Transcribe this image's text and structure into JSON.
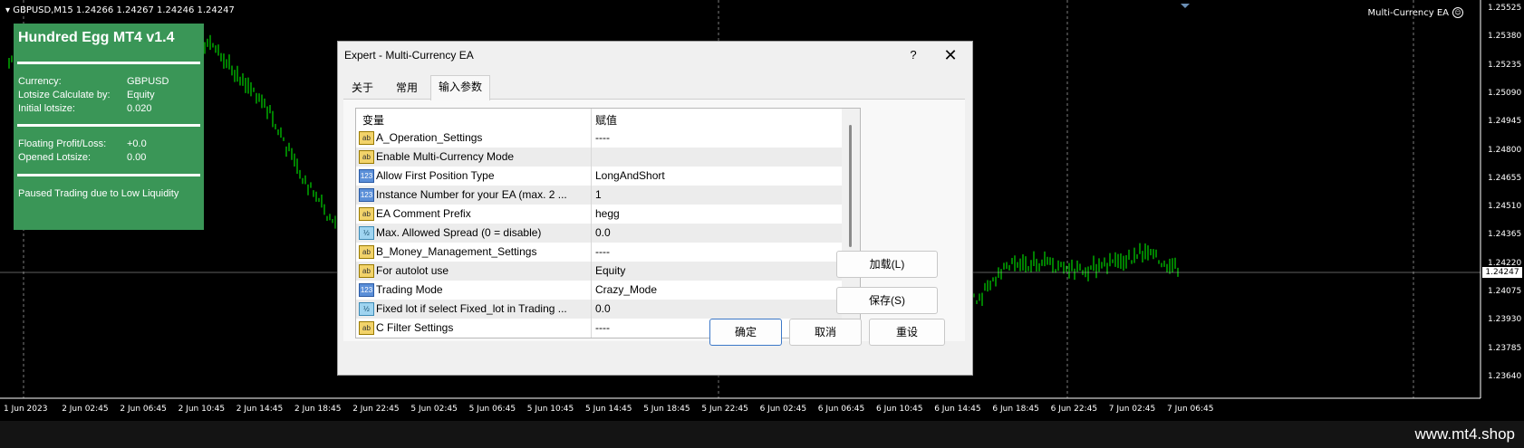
{
  "chart": {
    "symbol_label": "GBPUSD,M15  1.24266 1.24267 1.24246 1.24247",
    "ea_name": "Multi-Currency EA",
    "current_price": "1.24247",
    "price_ticks": [
      "1.25525",
      "1.25380",
      "1.25235",
      "1.25090",
      "1.24945",
      "1.24800",
      "1.24655",
      "1.24510",
      "1.24365",
      "1.24220",
      "1.24075",
      "1.23930",
      "1.23785",
      "1.23640"
    ],
    "time_ticks": [
      "1 Jun 2023",
      "2 Jun 02:45",
      "2 Jun 06:45",
      "2 Jun 10:45",
      "2 Jun 14:45",
      "2 Jun 18:45",
      "2 Jun 22:45",
      "5 Jun 02:45",
      "5 Jun 06:45",
      "5 Jun 10:45",
      "5 Jun 14:45",
      "5 Jun 18:45",
      "5 Jun 22:45",
      "6 Jun 02:45",
      "6 Jun 06:45",
      "6 Jun 10:45",
      "6 Jun 14:45",
      "6 Jun 18:45",
      "6 Jun 22:45",
      "7 Jun 02:45",
      "7 Jun 06:45"
    ],
    "candle_color": "#00ff00",
    "background": "#000000"
  },
  "info_panel": {
    "title": "Hundred Egg MT4 v1.4",
    "currency_label": "Currency:",
    "currency_value": "GBPUSD",
    "lotsize_calc_label": "Lotsize Calculate by:",
    "lotsize_calc_value": "Equity",
    "initial_lotsize_label": "Initial lotsize:",
    "initial_lotsize_value": "0.020",
    "floating_pl_label": "Floating Profit/Loss:",
    "floating_pl_value": "+0.0",
    "opened_lotsize_label": "Opened Lotsize:",
    "opened_lotsize_value": "0.00",
    "status": "Paused Trading due to Low Liquidity",
    "color": "#3a9657"
  },
  "dialog": {
    "title": "Expert - Multi-Currency EA",
    "help": "?",
    "close": "✕",
    "tabs": [
      "关于",
      "常用",
      "输入参数"
    ],
    "grid_headers": {
      "variable": "变量",
      "value": "赋值"
    },
    "params": [
      {
        "icon": "ab",
        "name": "A_Operation_Settings",
        "value": "----"
      },
      {
        "icon": "ab",
        "name": "Enable Multi-Currency Mode",
        "value": ""
      },
      {
        "icon": "123",
        "name": "Allow First Position Type",
        "value": "LongAndShort"
      },
      {
        "icon": "123",
        "name": "Instance Number for your EA (max. 2 ...",
        "value": "1"
      },
      {
        "icon": "ab",
        "name": "EA Comment Prefix",
        "value": "hegg"
      },
      {
        "icon": "½",
        "name": "Max. Allowed Spread (0 = disable)",
        "value": "0.0"
      },
      {
        "icon": "ab",
        "name": "B_Money_Management_Settings",
        "value": "----"
      },
      {
        "icon": "ab",
        "name": "For autolot use",
        "value": "Equity"
      },
      {
        "icon": "123",
        "name": "Trading Mode",
        "value": "Crazy_Mode"
      },
      {
        "icon": "½",
        "name": "Fixed lot if select Fixed_lot in Trading ...",
        "value": "0.0"
      },
      {
        "icon": "ab",
        "name": "C Filter Settings",
        "value": "----"
      }
    ],
    "load_button": "加载(L)",
    "save_button": "保存(S)",
    "ok_button": "确定",
    "cancel_button": "取消",
    "reset_button": "重设"
  },
  "footer": {
    "watermark": "www.mt4.shop"
  }
}
